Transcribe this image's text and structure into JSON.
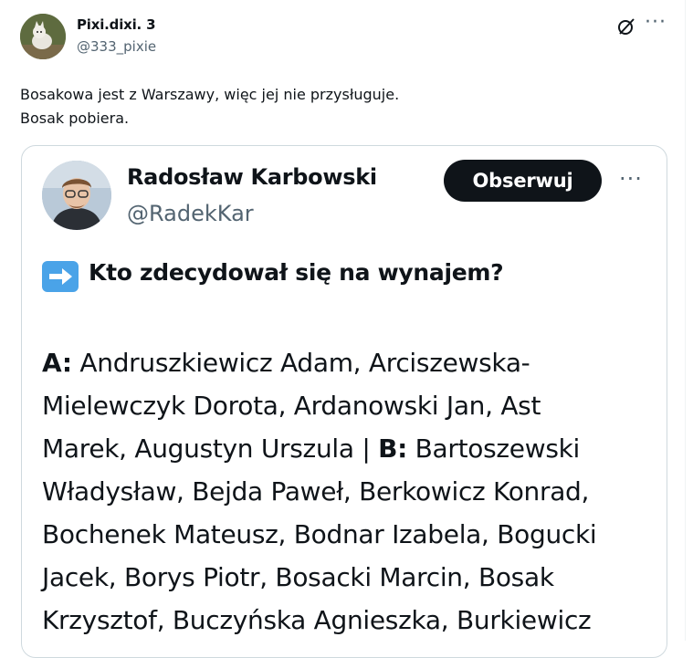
{
  "post": {
    "author_name": "Pixi.dixi. 3",
    "author_handle": "@333_pixie",
    "text_lines": [
      "Bosakowa jest z Warszawy, więc jej nie przysługuje.",
      "Bosak pobiera."
    ]
  },
  "quote": {
    "author_name": "Radosław Karbowski",
    "author_handle": "@RadekKar",
    "follow_label": "Obserwuj",
    "headline": "Kto zdecydował się na wynajem?",
    "body": {
      "line1_label": "A:",
      "line1_text": " Andruszkiewicz Adam, Arciszewska-",
      "line2": "Mielewczyk Dorota, Ardanowski Jan, Ast",
      "line3_text": "Marek, Augustyn Urszula | ",
      "line3_label": "B:",
      "line3_rest": " Bartoszewski",
      "line4": "Władysław, Bejda Paweł, Berkowicz Konrad,",
      "line5": "Bochenek Mateusz, Bodnar Izabela, Bogucki",
      "line6": "Jacek, Borys Piotr, Bosacki Marcin, Bosak",
      "line7": "Krzysztof, Buczyńska Agnieszka, Burkiewicz"
    }
  },
  "icons": {
    "grok": "grok-icon",
    "more": "more-icon",
    "arrow": "right-arrow-emoji-icon"
  },
  "colors": {
    "text": "#0f1419",
    "secondary": "#536471",
    "border": "#cfd9de",
    "follow_bg": "#0f1419",
    "arrow_emoji_bg": "#4aa3e8"
  }
}
